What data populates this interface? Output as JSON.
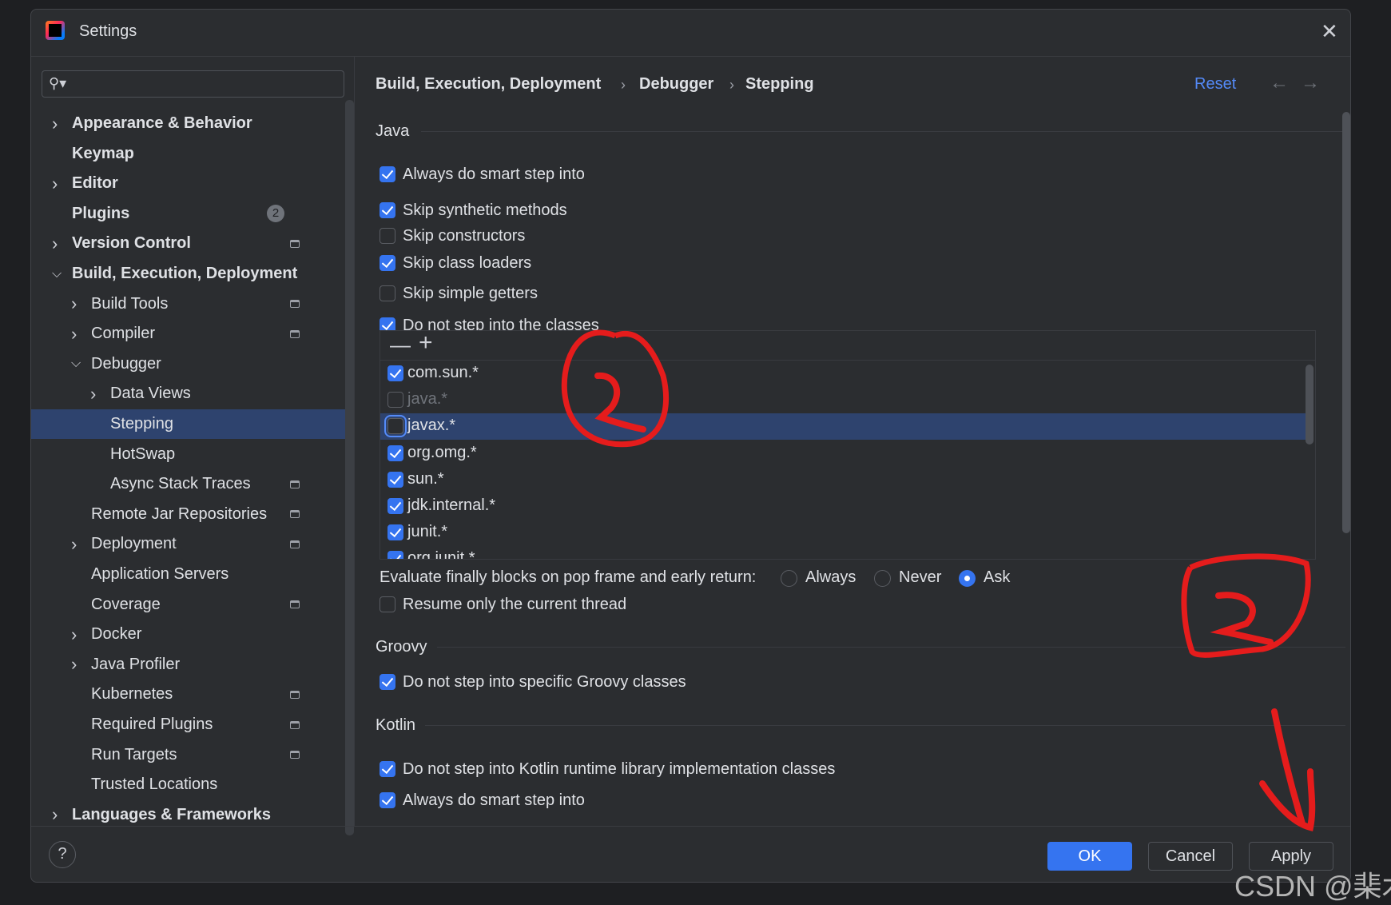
{
  "window": {
    "title": "Settings",
    "close_icon": "close-icon"
  },
  "search": {
    "placeholder": "",
    "value": ""
  },
  "sidebar": {
    "items": [
      {
        "label": "Appearance & Behavior",
        "level": 0,
        "expandable": true,
        "expanded": false,
        "top": true
      },
      {
        "label": "Keymap",
        "level": 0,
        "top": true
      },
      {
        "label": "Editor",
        "level": 0,
        "expandable": true,
        "expanded": false,
        "top": true
      },
      {
        "label": "Plugins",
        "level": 0,
        "top": true,
        "badge": "2"
      },
      {
        "label": "Version Control",
        "level": 0,
        "expandable": true,
        "expanded": false,
        "top": true,
        "project": true
      },
      {
        "label": "Build, Execution, Deployment",
        "level": 0,
        "expandable": true,
        "expanded": true,
        "top": true
      },
      {
        "label": "Build Tools",
        "level": 1,
        "expandable": true,
        "expanded": false,
        "project": true
      },
      {
        "label": "Compiler",
        "level": 1,
        "expandable": true,
        "expanded": false,
        "project": true
      },
      {
        "label": "Debugger",
        "level": 1,
        "expandable": true,
        "expanded": true
      },
      {
        "label": "Data Views",
        "level": 2,
        "expandable": true,
        "expanded": false
      },
      {
        "label": "Stepping",
        "level": 2,
        "selected": true
      },
      {
        "label": "HotSwap",
        "level": 2
      },
      {
        "label": "Async Stack Traces",
        "level": 2,
        "project": true
      },
      {
        "label": "Remote Jar Repositories",
        "level": 1,
        "project": true
      },
      {
        "label": "Deployment",
        "level": 1,
        "expandable": true,
        "expanded": false,
        "project": true
      },
      {
        "label": "Application Servers",
        "level": 1
      },
      {
        "label": "Coverage",
        "level": 1,
        "project": true
      },
      {
        "label": "Docker",
        "level": 1,
        "expandable": true,
        "expanded": false
      },
      {
        "label": "Java Profiler",
        "level": 1,
        "expandable": true,
        "expanded": false
      },
      {
        "label": "Kubernetes",
        "level": 1,
        "project": true
      },
      {
        "label": "Required Plugins",
        "level": 1,
        "project": true
      },
      {
        "label": "Run Targets",
        "level": 1,
        "project": true
      },
      {
        "label": "Trusted Locations",
        "level": 1
      },
      {
        "label": "Languages & Frameworks",
        "level": 0,
        "expandable": true,
        "expanded": false,
        "top": true
      }
    ]
  },
  "header": {
    "breadcrumb": [
      "Build, Execution, Deployment",
      "Debugger",
      "Stepping"
    ],
    "separator": "›",
    "reset_label": "Reset"
  },
  "java": {
    "title": "Java",
    "options": [
      {
        "label": "Always do smart step into",
        "checked": true
      },
      {
        "label": "Skip synthetic methods",
        "checked": true
      },
      {
        "label": "Skip constructors",
        "checked": false
      },
      {
        "label": "Skip class loaders",
        "checked": true
      },
      {
        "label": "Skip simple getters",
        "checked": false
      },
      {
        "label": "Do not step into the classes",
        "checked": true
      }
    ],
    "class_filters": [
      {
        "pattern": "com.sun.*",
        "checked": true
      },
      {
        "pattern": "java.*",
        "checked": false,
        "disabled": true
      },
      {
        "pattern": "javax.*",
        "checked": false,
        "selected": true
      },
      {
        "pattern": "org.omg.*",
        "checked": true
      },
      {
        "pattern": "sun.*",
        "checked": true
      },
      {
        "pattern": "jdk.internal.*",
        "checked": true
      },
      {
        "pattern": "junit.*",
        "checked": true
      },
      {
        "pattern": "org.junit.*",
        "checked": true
      }
    ],
    "evaluate_label": "Evaluate finally blocks on pop frame and early return:",
    "evaluate_options": [
      "Always",
      "Never",
      "Ask"
    ],
    "evaluate_selected": "Ask",
    "resume_label": "Resume only the current thread",
    "resume_checked": false
  },
  "groovy": {
    "title": "Groovy",
    "option": {
      "label": "Do not step into specific Groovy classes",
      "checked": true
    }
  },
  "kotlin": {
    "title": "Kotlin",
    "options": [
      {
        "label": "Do not step into Kotlin runtime library implementation classes",
        "checked": true
      },
      {
        "label": "Always do smart step into",
        "checked": true
      }
    ]
  },
  "footer": {
    "ok": "OK",
    "cancel": "Cancel",
    "apply": "Apply",
    "help": "?"
  },
  "watermark": "CSDN @棐木",
  "colors": {
    "accent": "#3574f0",
    "selection": "#2e436e",
    "link": "#548af7",
    "annotation": "#e51c1c"
  }
}
